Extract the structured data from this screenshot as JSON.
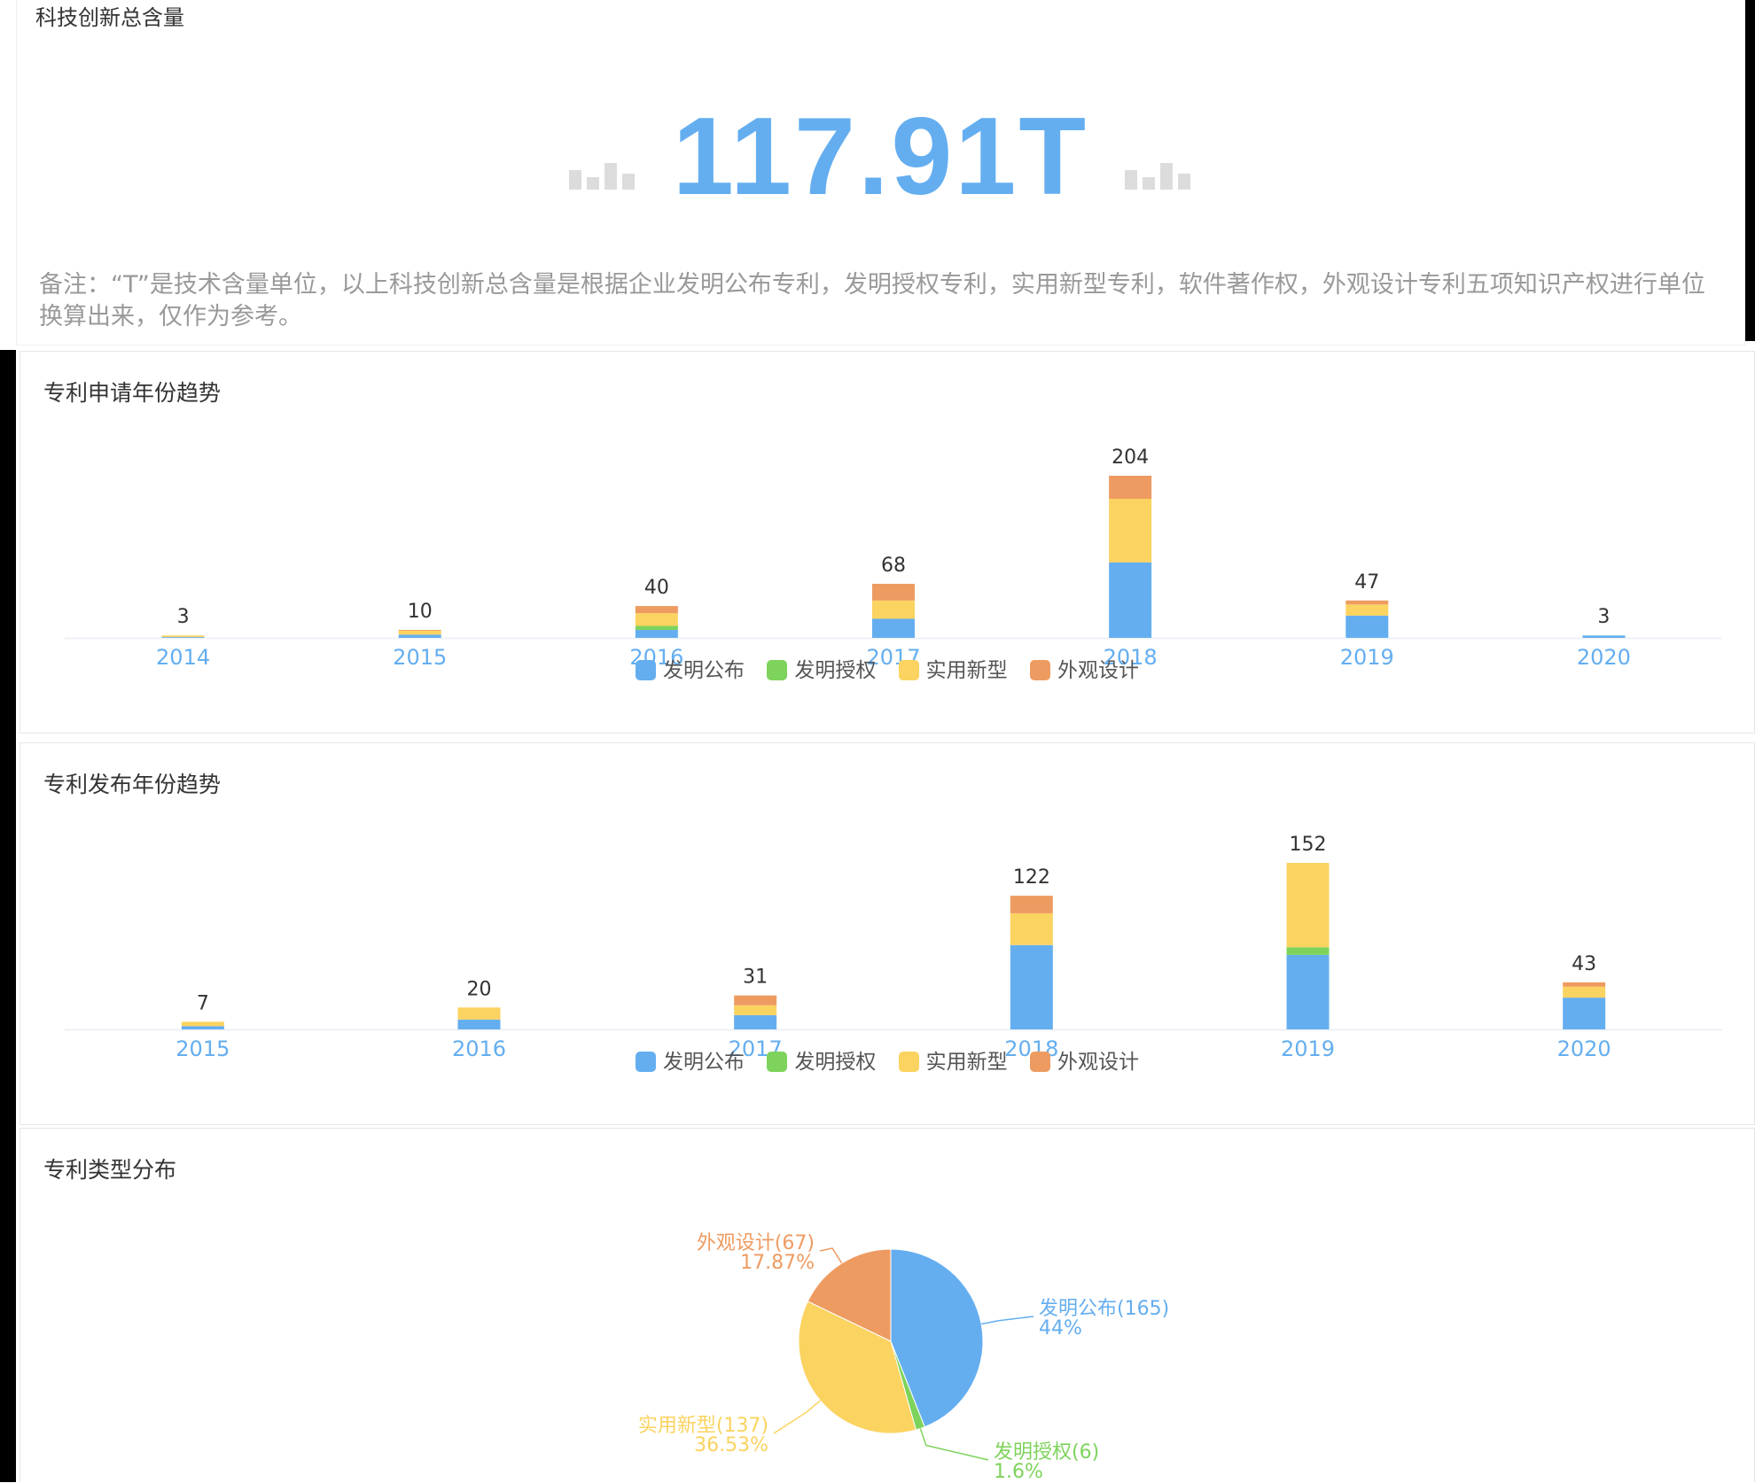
{
  "total_panel": {
    "title": "科技创新总含量",
    "value": "117.91T",
    "note": "备注：“T”是技术含量单位，以上科技创新总含量是根据企业发明公布专利，发明授权专利，实用新型专利，软件著作权，外观设计专利五项知识产权进行单位换算出来，仅作为参考。"
  },
  "colors": {
    "发明公布": "#64aef0",
    "发明授权": "#7ed35c",
    "实用新型": "#fbd360",
    "外观设计": "#ee9b61",
    "axis_label": "#64aef0",
    "value_label": "#333333",
    "decor_bars": "#dcdcdc"
  },
  "legend": [
    "发明公布",
    "发明授权",
    "实用新型",
    "外观设计"
  ],
  "chart_data": [
    {
      "type": "bar",
      "stacked": true,
      "title": "专利申请年份趋势",
      "categories": [
        "2014",
        "2015",
        "2016",
        "2017",
        "2018",
        "2019",
        "2020"
      ],
      "totals": [
        3,
        10,
        40,
        68,
        204,
        47,
        3
      ],
      "series": [
        {
          "name": "发明公布",
          "values": [
            1,
            4,
            10,
            24,
            95,
            28,
            3
          ]
        },
        {
          "name": "发明授权",
          "values": [
            0,
            0,
            5,
            0,
            0,
            0,
            0
          ]
        },
        {
          "name": "实用新型",
          "values": [
            2,
            5,
            16,
            23,
            80,
            14,
            0
          ]
        },
        {
          "name": "外观设计",
          "values": [
            0,
            1,
            9,
            21,
            29,
            5,
            0
          ]
        }
      ],
      "ylim": [
        0,
        204
      ],
      "legend_position": "bottom",
      "grid": false
    },
    {
      "type": "bar",
      "stacked": true,
      "title": "专利发布年份趋势",
      "categories": [
        "2015",
        "2016",
        "2017",
        "2018",
        "2019",
        "2020"
      ],
      "totals": [
        7,
        20,
        31,
        122,
        152,
        43
      ],
      "series": [
        {
          "name": "发明公布",
          "values": [
            3,
            9,
            13,
            77,
            68,
            29
          ]
        },
        {
          "name": "发明授权",
          "values": [
            0,
            0,
            0,
            0,
            7,
            0
          ]
        },
        {
          "name": "实用新型",
          "values": [
            4,
            11,
            9,
            29,
            77,
            10
          ]
        },
        {
          "name": "外观设计",
          "values": [
            0,
            0,
            9,
            16,
            0,
            4
          ]
        }
      ],
      "ylim": [
        0,
        152
      ],
      "legend_position": "bottom",
      "grid": false
    },
    {
      "type": "pie",
      "title": "专利类型分布",
      "slices": [
        {
          "name": "发明公布",
          "value": 165,
          "percent": "44%",
          "label": "发明公布(165)"
        },
        {
          "name": "发明授权",
          "value": 6,
          "percent": "1.6%",
          "label": "发明授权(6)"
        },
        {
          "name": "实用新型",
          "value": 137,
          "percent": "36.53%",
          "label": "实用新型(137)"
        },
        {
          "name": "外观设计",
          "value": 67,
          "percent": "17.87%",
          "label": "外观设计(67)"
        }
      ]
    }
  ]
}
